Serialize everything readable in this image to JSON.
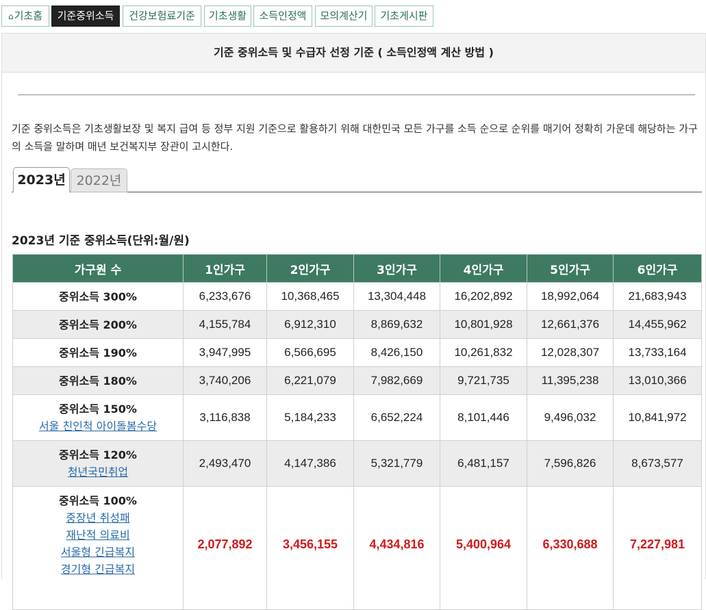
{
  "nav": {
    "tabs": [
      {
        "label": "기초홈",
        "icon": "home-icon",
        "active": false
      },
      {
        "label": "기준중위소득",
        "active": true
      },
      {
        "label": "건강보험료기준",
        "active": false
      },
      {
        "label": "기초생활",
        "active": false
      },
      {
        "label": "소득인정액",
        "active": false
      },
      {
        "label": "모의계산기",
        "active": false
      },
      {
        "label": "기초게시판",
        "active": false
      }
    ]
  },
  "panel": {
    "title": "기준 중위소득 및 수급자 선정 기준 ( 소득인정액 계산 방법 )",
    "description": "기준 중위소득은 기초생활보장 및 복지 급여 등 정부 지원 기준으로 활용하기 위해 대한민국 모든 가구를 소득 순으로 순위를 매기어 정확히 가운데 해당하는 가구의 소득을 말하며 매년 보건복지부 장관이 고시한다."
  },
  "year_tabs": [
    {
      "label": "2023년",
      "active": true
    },
    {
      "label": "2022년",
      "active": false
    }
  ],
  "section_title": "2023년 기준 중위소득(단위:월/원)",
  "table": {
    "headers": [
      "가구원 수",
      "1인가구",
      "2인가구",
      "3인가구",
      "4인가구",
      "5인가구",
      "6인가구"
    ],
    "rows": [
      {
        "label": "중위소득 300%",
        "links": [],
        "values": [
          "6,233,676",
          "10,368,465",
          "13,304,448",
          "16,202,892",
          "18,992,064",
          "21,683,943"
        ]
      },
      {
        "label": "중위소득 200%",
        "links": [],
        "values": [
          "4,155,784",
          "6,912,310",
          "8,869,632",
          "10,801,928",
          "12,661,376",
          "14,455,962"
        ]
      },
      {
        "label": "중위소득 190%",
        "links": [],
        "values": [
          "3,947,995",
          "6,566,695",
          "8,426,150",
          "10,261,832",
          "12,028,307",
          "13,733,164"
        ]
      },
      {
        "label": "중위소득 180%",
        "links": [],
        "values": [
          "3,740,206",
          "6,221,079",
          "7,982,669",
          "9,721,735",
          "11,395,238",
          "13,010,366"
        ]
      },
      {
        "label": "중위소득 150%",
        "links": [
          "서울 친인척 아이돌봄수당"
        ],
        "values": [
          "3,116,838",
          "5,184,233",
          "6,652,224",
          "8,101,446",
          "9,496,032",
          "10,841,972"
        ]
      },
      {
        "label": "중위소득 120%",
        "links": [
          "청년국민취업"
        ],
        "values": [
          "2,493,470",
          "4,147,386",
          "5,321,779",
          "6,481,157",
          "7,596,826",
          "8,673,577"
        ]
      },
      {
        "label": "중위소득 100%",
        "links": [
          "중장년 취성패",
          "재난적 의료비",
          "서울형 긴급복지",
          "경기형 긴급복지"
        ],
        "values": [
          "2,077,892",
          "3,456,155",
          "4,434,816",
          "5,400,964",
          "6,330,688",
          "7,227,981"
        ],
        "highlight": true
      }
    ]
  },
  "colors": {
    "header_green": "#3e7a61",
    "highlight_red": "#d11a1a",
    "link_blue": "#2a6aa8",
    "alt_row_gray": "#ececec"
  }
}
